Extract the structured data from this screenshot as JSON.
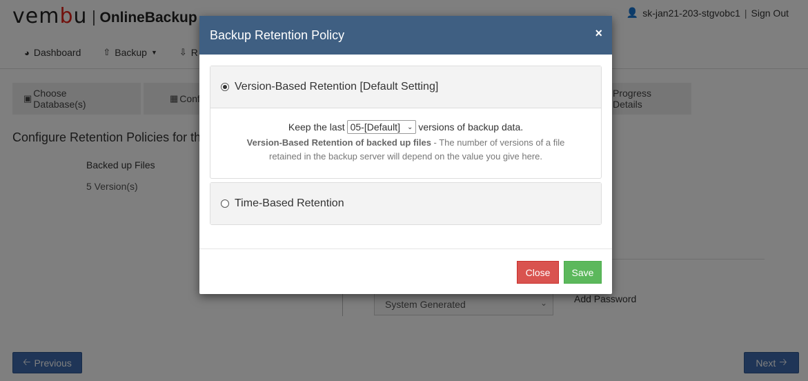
{
  "app": {
    "brand_prefix": "vem",
    "brand_mid": "b",
    "brand_suffix": "u",
    "product": "OnlineBackup",
    "user": "sk-jan21-203-stgvobc1",
    "user_sep": "|",
    "sign_out": "Sign Out"
  },
  "nav": {
    "dashboard": "Dashboard",
    "backup": "Backup",
    "restore": "R"
  },
  "steps": {
    "step1": "Choose Database(s)",
    "step2": "Confi",
    "step3": "Progress Details"
  },
  "main": {
    "section_title": "Configure Retention Policies for th",
    "backed_up_files_label": "Backed up Files",
    "versions_value": "5 Version(s)",
    "encryption_select": "System Generated",
    "add_password": "Add Password"
  },
  "footer": {
    "previous": "Previous",
    "next": "Next"
  },
  "modal": {
    "title": "Backup Retention Policy",
    "close_symbol": "×",
    "option_version": "Version-Based Retention [Default Setting]",
    "keep_prefix": "Keep the last",
    "versions_selected": "05-[Default]",
    "keep_suffix": "versions of backup data.",
    "desc_bold": "Version-Based Retention of backed up files",
    "desc_rest": " - The number of versions of a file retained in the backup server will depend on the value you give here.",
    "option_time": "Time-Based Retention",
    "close_button": "Close",
    "save_button": "Save"
  },
  "colors": {
    "modal_header": "#3f5f82",
    "close_button": "#d9534f",
    "save_button": "#5cb85c",
    "nav_button": "#3e6bae",
    "brand_accent": "#e2231a"
  }
}
